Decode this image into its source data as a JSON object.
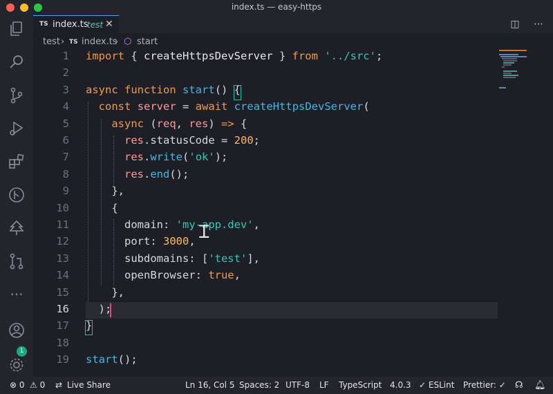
{
  "window": {
    "title": "index.ts — easy-https"
  },
  "tab": {
    "lang_badge": "TS",
    "filename": "index.ts",
    "folder": "test",
    "close_glyph": "✕"
  },
  "tab_actions": {
    "split": "◫",
    "more": "⋯"
  },
  "breadcrumb": {
    "folder": "test",
    "sep1": "›",
    "lang_badge": "TS",
    "file": "index.ts",
    "sep2": "›",
    "symbol_icon": "⬡",
    "symbol": "start"
  },
  "editor": {
    "active_line": 16,
    "line_numbers": [
      "1",
      "2",
      "3",
      "4",
      "5",
      "6",
      "7",
      "8",
      "9",
      "10",
      "11",
      "12",
      "13",
      "14",
      "15",
      "16",
      "17",
      "18",
      "19"
    ],
    "lines": [
      [
        {
          "t": "import",
          "c": "k"
        },
        {
          "t": " { ",
          "c": "p"
        },
        {
          "t": "createHttpsDevServer",
          "c": "plain"
        },
        {
          "t": " } ",
          "c": "p"
        },
        {
          "t": "from",
          "c": "k"
        },
        {
          "t": " ",
          "c": "p"
        },
        {
          "t": "'../src'",
          "c": "s"
        },
        {
          "t": ";",
          "c": "p"
        }
      ],
      [],
      [
        {
          "t": "async",
          "c": "k"
        },
        {
          "t": " ",
          "c": "p"
        },
        {
          "t": "function",
          "c": "k"
        },
        {
          "t": " ",
          "c": "p"
        },
        {
          "t": "start",
          "c": "f"
        },
        {
          "t": "() {",
          "c": "p"
        }
      ],
      [
        {
          "t": "  ",
          "c": "p"
        },
        {
          "t": "const",
          "c": "k"
        },
        {
          "t": " ",
          "c": "p"
        },
        {
          "t": "server",
          "c": "v"
        },
        {
          "t": " = ",
          "c": "p"
        },
        {
          "t": "await",
          "c": "k"
        },
        {
          "t": " ",
          "c": "p"
        },
        {
          "t": "createHttpsDevServer",
          "c": "f"
        },
        {
          "t": "(",
          "c": "p"
        }
      ],
      [
        {
          "t": "    ",
          "c": "p"
        },
        {
          "t": "async",
          "c": "k"
        },
        {
          "t": " (",
          "c": "p"
        },
        {
          "t": "req",
          "c": "v"
        },
        {
          "t": ", ",
          "c": "p"
        },
        {
          "t": "res",
          "c": "v"
        },
        {
          "t": ") ",
          "c": "p"
        },
        {
          "t": "=>",
          "c": "k"
        },
        {
          "t": " {",
          "c": "p"
        }
      ],
      [
        {
          "t": "      ",
          "c": "p"
        },
        {
          "t": "res",
          "c": "v"
        },
        {
          "t": ".statusCode = ",
          "c": "p"
        },
        {
          "t": "200",
          "c": "n"
        },
        {
          "t": ";",
          "c": "p"
        }
      ],
      [
        {
          "t": "      ",
          "c": "p"
        },
        {
          "t": "res",
          "c": "v"
        },
        {
          "t": ".",
          "c": "p"
        },
        {
          "t": "write",
          "c": "f"
        },
        {
          "t": "(",
          "c": "p"
        },
        {
          "t": "'ok'",
          "c": "s"
        },
        {
          "t": ");",
          "c": "p"
        }
      ],
      [
        {
          "t": "      ",
          "c": "p"
        },
        {
          "t": "res",
          "c": "v"
        },
        {
          "t": ".",
          "c": "p"
        },
        {
          "t": "end",
          "c": "f"
        },
        {
          "t": "();",
          "c": "p"
        }
      ],
      [
        {
          "t": "    },",
          "c": "p"
        }
      ],
      [
        {
          "t": "    {",
          "c": "p"
        }
      ],
      [
        {
          "t": "      domain: ",
          "c": "p"
        },
        {
          "t": "'my-app.dev'",
          "c": "s"
        },
        {
          "t": ",",
          "c": "p"
        }
      ],
      [
        {
          "t": "      port: ",
          "c": "p"
        },
        {
          "t": "3000",
          "c": "n"
        },
        {
          "t": ",",
          "c": "p"
        }
      ],
      [
        {
          "t": "      subdomains: [",
          "c": "p"
        },
        {
          "t": "'test'",
          "c": "s"
        },
        {
          "t": "],",
          "c": "p"
        }
      ],
      [
        {
          "t": "      openBrowser: ",
          "c": "p"
        },
        {
          "t": "true",
          "c": "k"
        },
        {
          "t": ",",
          "c": "p"
        }
      ],
      [
        {
          "t": "    },",
          "c": "p"
        }
      ],
      [
        {
          "t": "  );",
          "c": "p"
        }
      ],
      [
        {
          "t": "}",
          "c": "p"
        }
      ],
      [],
      [
        {
          "t": "start",
          "c": "f"
        },
        {
          "t": "();",
          "c": "p"
        }
      ]
    ]
  },
  "activity_icons": [
    "explorer-icon",
    "search-icon",
    "source-control-icon",
    "run-debug-icon",
    "extensions-icon",
    "git-graph-icon",
    "tree-icon",
    "pull-request-icon",
    "more-icon",
    "account-icon",
    "settings-gear-icon"
  ],
  "account_badge": "1",
  "status": {
    "errors": "⊗ 0",
    "warnings": "⚠ 0",
    "live_share": "Live Share",
    "cursor_pos": "Ln 16, Col 5",
    "spaces": "Spaces: 2",
    "encoding": "UTF-8",
    "eol": "LF",
    "language": "TypeScript",
    "ts_version": "4.0.3",
    "eslint": "✓ ESLint",
    "prettier": "Prettier: ✓",
    "feedback_icon": "feedback-icon",
    "bell_icon": "bell-icon"
  },
  "colors": {
    "accent": "#4da3ff",
    "keyword": "#f29a4a",
    "function": "#3fb8e6",
    "string": "#35c6b4",
    "number": "#ffb860",
    "variable": "#ff9999",
    "cursor": "#e04a7b"
  }
}
